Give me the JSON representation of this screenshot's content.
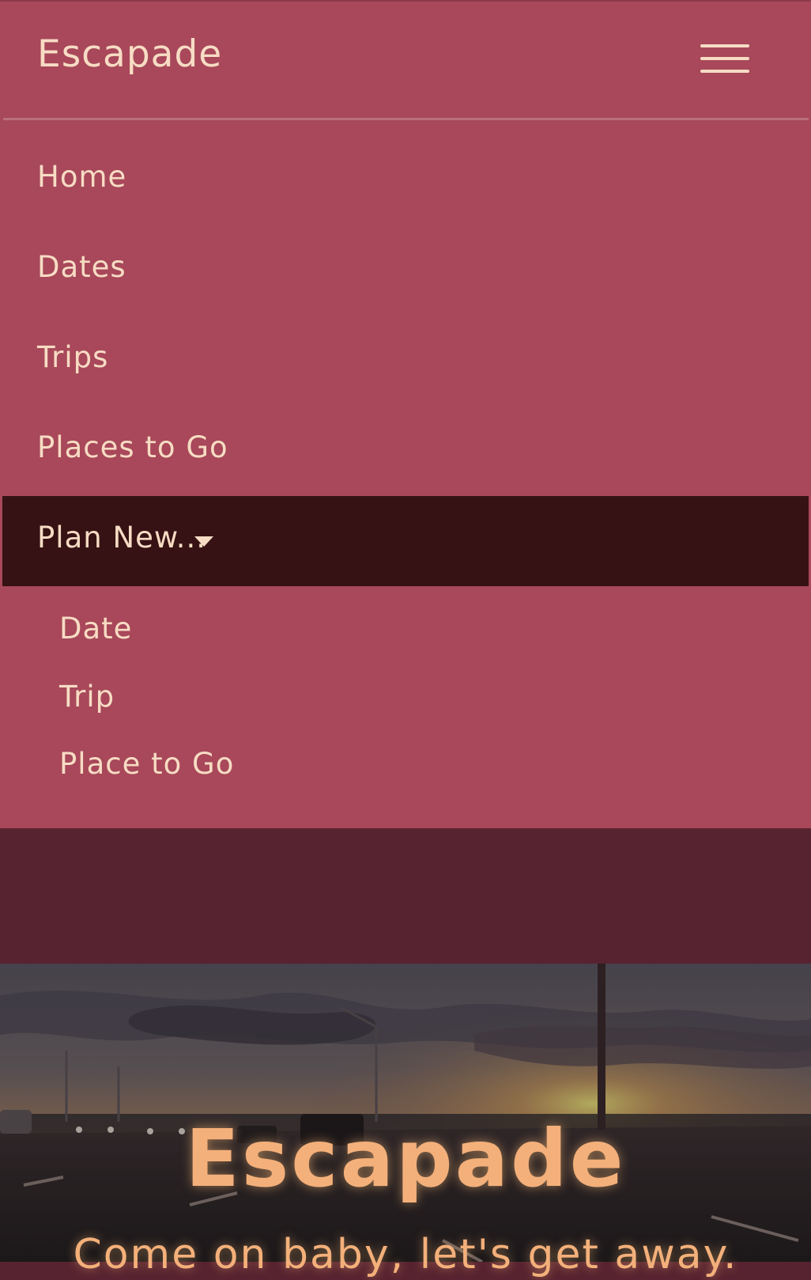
{
  "navbar": {
    "brand": "Escapade",
    "toggler_icon": "hamburger-icon",
    "items": [
      {
        "label": "Home"
      },
      {
        "label": "Dates"
      },
      {
        "label": "Trips"
      },
      {
        "label": "Places to Go"
      }
    ],
    "dropdown": {
      "label": "Plan New...",
      "caret_icon": "caret-down-icon",
      "items": [
        {
          "label": "Date"
        },
        {
          "label": "Trip"
        },
        {
          "label": "Place to Go"
        }
      ]
    }
  },
  "hero": {
    "title": "Escapade",
    "subtitle": "Come on baby, let's get away."
  },
  "colors": {
    "navbar_bg": "#a8485a",
    "active_bg": "#361214",
    "page_bg": "#582330",
    "text": "#f7dcc4",
    "hero_text": "#f4b07a"
  }
}
